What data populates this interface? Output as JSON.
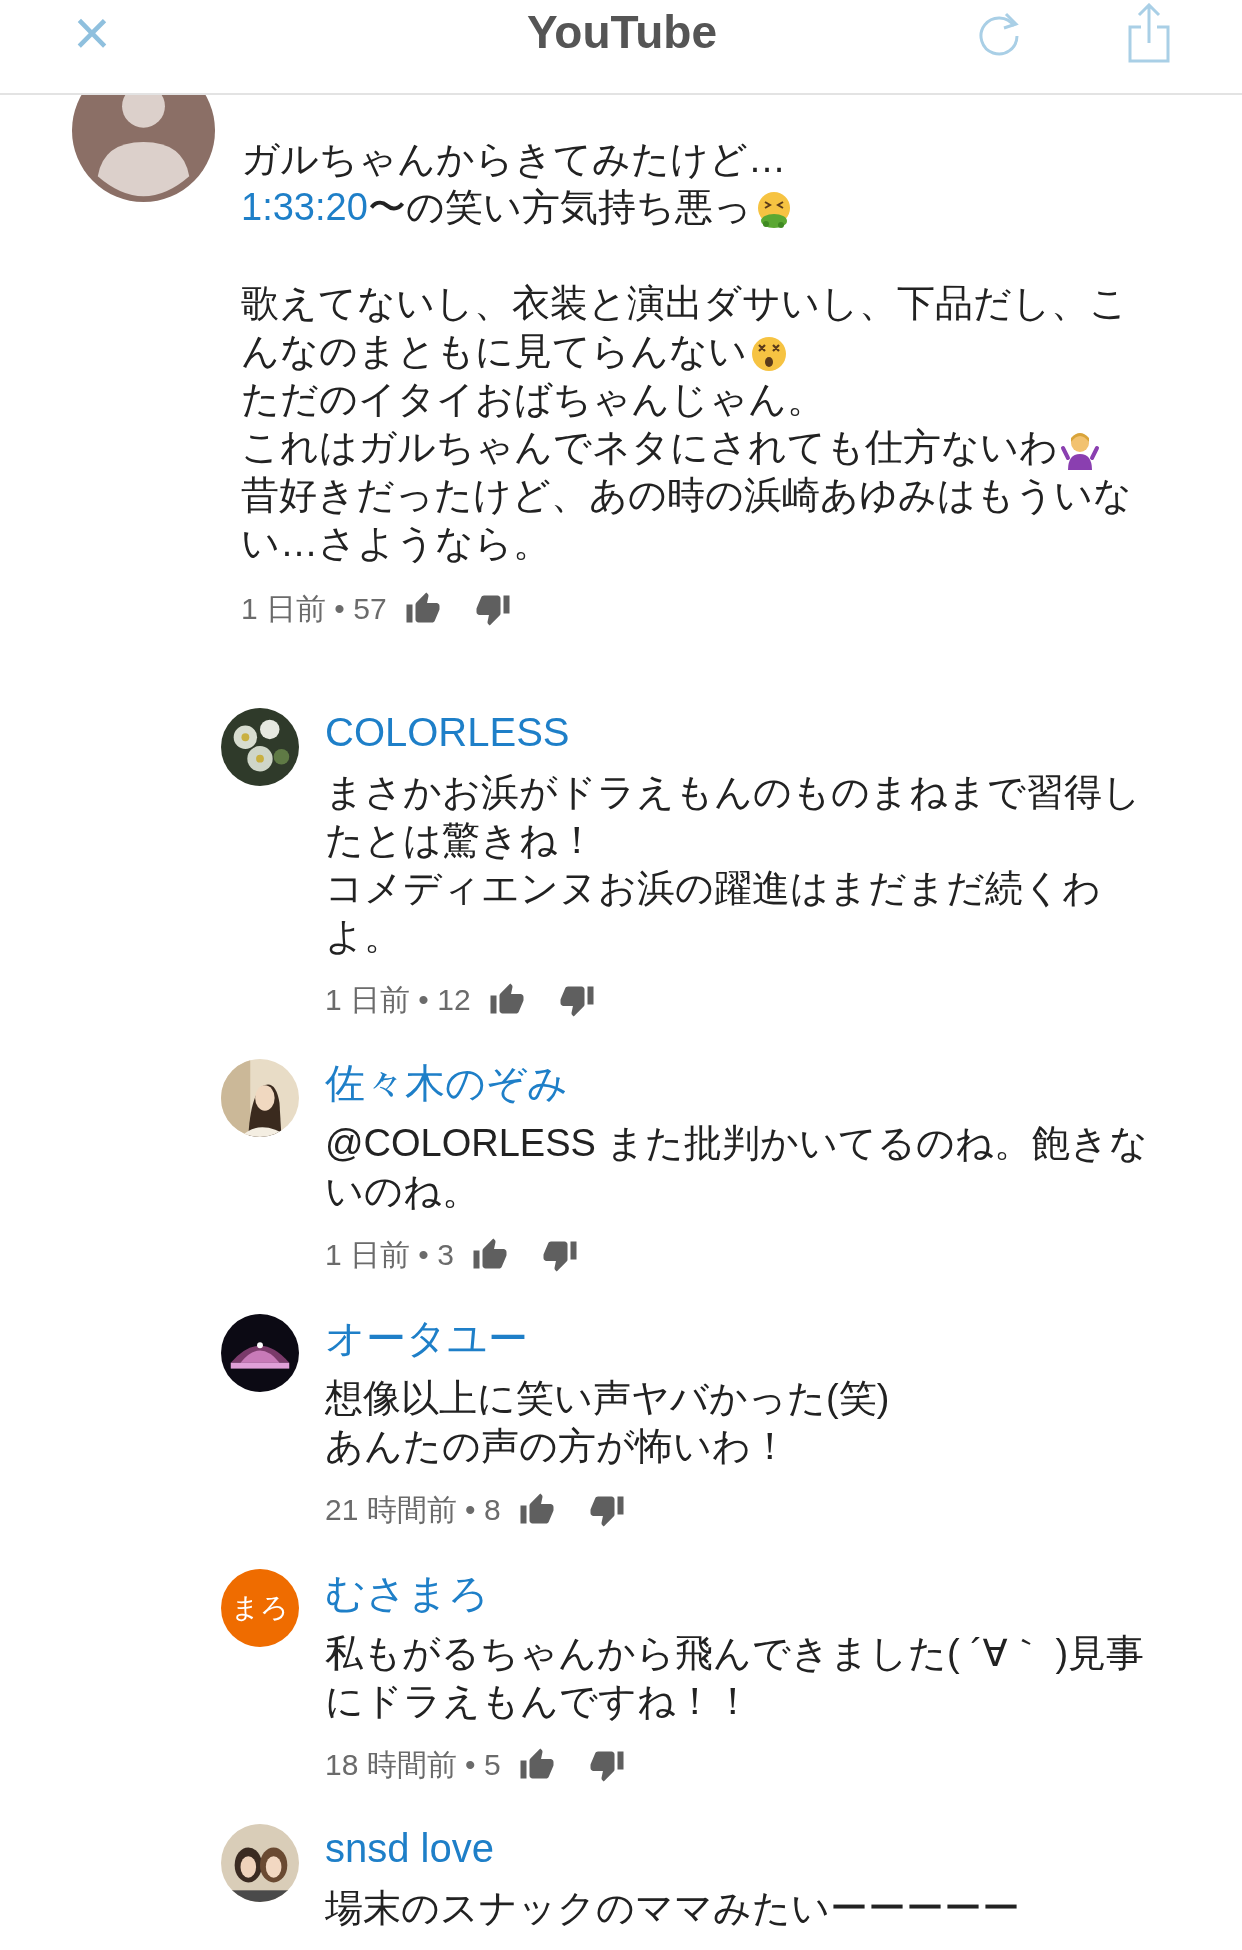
{
  "header": {
    "close": "×",
    "title": "YouTube"
  },
  "comment": {
    "avatar": {
      "kind": "default"
    },
    "blocks": [
      [
        [
          {
            "kind": "text",
            "text": "ガルちゃんからきてみたけど…"
          }
        ],
        [
          {
            "kind": "link",
            "text": "1:33:20"
          },
          {
            "kind": "text",
            "text": "〜の笑い方気持ち悪っ"
          },
          {
            "kind": "nauseated"
          }
        ]
      ],
      [
        [
          {
            "kind": "text",
            "text": "歌えてないし、衣装と演出ダサいし、下品だし、こ"
          }
        ],
        [
          {
            "kind": "text",
            "text": "んなのまともに見てらんない"
          },
          {
            "kind": "dizzy"
          }
        ],
        [
          {
            "kind": "text",
            "text": "ただのイタイおばちゃんじゃん。"
          }
        ],
        [
          {
            "kind": "text",
            "text": "これはガルちゃんでネタにされても仕方ないわ"
          },
          {
            "kind": "shrug"
          }
        ],
        [
          {
            "kind": "text",
            "text": "昔好きだったけど、あの時の浜崎あゆみはもういな"
          }
        ],
        [
          {
            "kind": "text",
            "text": "い…さようなら。"
          }
        ]
      ]
    ],
    "meta": "1 日前 • 57"
  },
  "replies": [
    {
      "avatar": {
        "kind": "picture"
      },
      "author": "COLORLESS",
      "lines": [
        "まさかお浜がドラえもんのものまねまで習得したとは驚きね！",
        "コメディエンヌお浜の躍進はまだまだ続くわよ。"
      ],
      "meta": "1 日前 • 12"
    },
    {
      "avatar": {
        "kind": "picture"
      },
      "author": "佐々木のぞみ",
      "lines": [
        "@COLORLESS また批判かいてるのね。飽きないのね。"
      ],
      "meta": "1 日前 • 3"
    },
    {
      "avatar": {
        "kind": "picture"
      },
      "author": "オータユー",
      "lines": [
        "想像以上に笑い声ヤバかった(笑)",
        "あんたの声の方が怖いわ！"
      ],
      "meta": "21 時間前 • 8"
    },
    {
      "avatar": {
        "kind": "initials",
        "text": "まろ"
      },
      "author": "むさまろ",
      "lines": [
        "私もがるちゃんから飛んできました( ´∀｀ )見事にドラえもんですね！！"
      ],
      "meta": "18 時間前 • 5"
    },
    {
      "avatar": {
        "kind": "picture"
      },
      "author": "snsd love",
      "lines": [
        "場末のスナックのママみたいーーーーー"
      ]
    }
  ]
}
